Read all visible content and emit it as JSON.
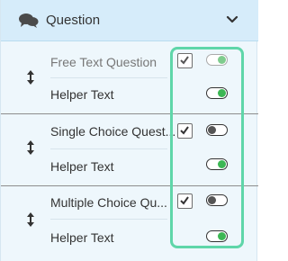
{
  "header": {
    "title": "Question",
    "icon": "chat-bubbles-icon",
    "chevron": "chevron-down-icon"
  },
  "colors": {
    "accent": "#3cb754",
    "highlight": "#5fd6a9",
    "header_bg": "#d6ecfa"
  },
  "groups": [
    {
      "question": "Free Text Question",
      "question_checked": true,
      "question_toggle": "on",
      "helper": "Helper Text",
      "helper_toggle": "on"
    },
    {
      "question": "Single Choice Quest...",
      "question_checked": true,
      "question_toggle": "off",
      "helper": "Helper Text",
      "helper_toggle": "on"
    },
    {
      "question": "Multiple Choice Qu...",
      "question_checked": true,
      "question_toggle": "off",
      "helper": "Helper Text",
      "helper_toggle": "on"
    }
  ]
}
